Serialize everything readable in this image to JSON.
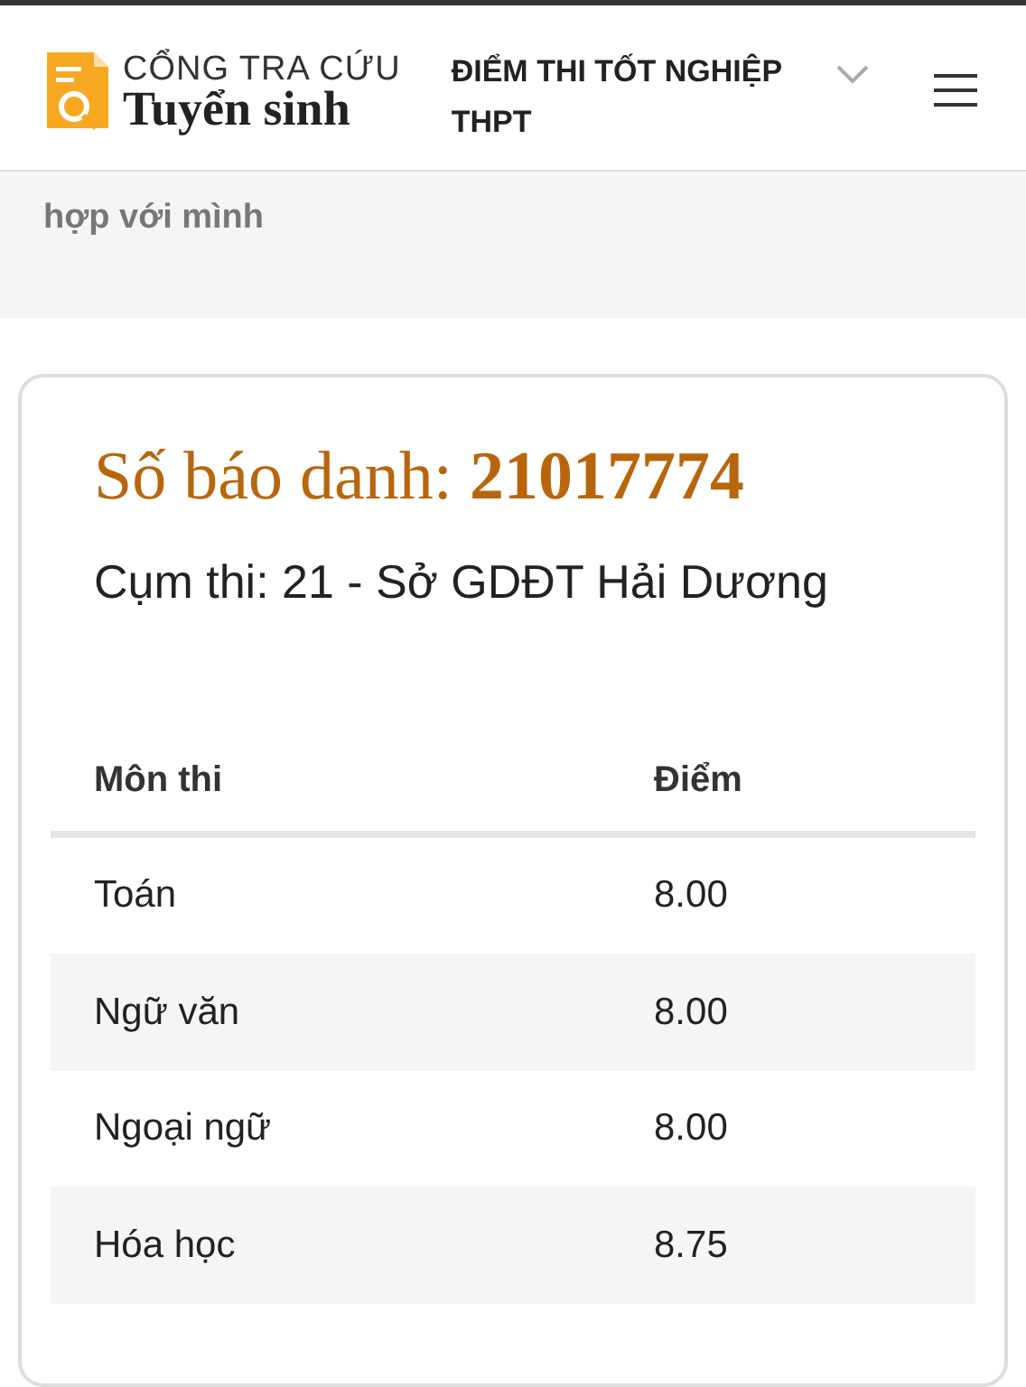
{
  "header": {
    "logo_top": "CỔNG TRA CỨU",
    "logo_bottom": "Tuyển sinh",
    "nav_title": "ĐIỂM THI TỐT NGHIỆP THPT"
  },
  "intro": {
    "text": "hợp với mình"
  },
  "result": {
    "title": "Số báo danh: **21017774**",
    "cluster": "Cụm thi: 21 - Sở GDĐT Hải Dương"
  },
  "table": {
    "columns": [
      "Môn thi",
      "Điểm"
    ],
    "rows": [
      {
        "subject": "Toán",
        "score": "8.00"
      },
      {
        "subject": "Ngữ văn",
        "score": "8.00"
      },
      {
        "subject": "Ngoại ngữ",
        "score": "8.00"
      },
      {
        "subject": "Hóa học",
        "score": "8.75"
      }
    ]
  }
}
